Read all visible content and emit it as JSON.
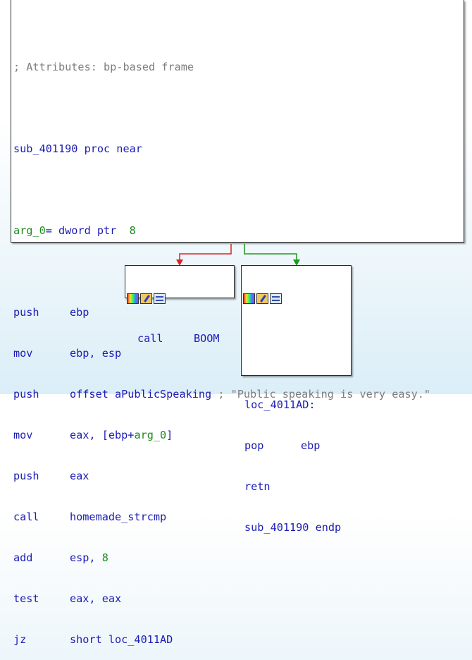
{
  "main_block": {
    "comment": "; Attributes: bp-based frame",
    "proc_name": "sub_401190",
    "proc_keyword": "proc near",
    "arg_name": "arg_0",
    "arg_def": "= dword ptr  ",
    "arg_offset": "8",
    "instructions": [
      {
        "mnemonic": "push",
        "operand": "ebp"
      },
      {
        "mnemonic": "mov",
        "operand": "ebp, esp"
      },
      {
        "mnemonic": "push",
        "operand": "offset aPublicSpeaking",
        "comment": " ; \"Public speaking is very easy.\""
      },
      {
        "mnemonic": "mov",
        "operand_pre": "eax, [ebp+",
        "operand_arg": "arg_0",
        "operand_post": "]"
      },
      {
        "mnemonic": "push",
        "operand": "eax"
      },
      {
        "mnemonic": "call",
        "operand": "homemade_strcmp"
      },
      {
        "mnemonic": "add",
        "operand_pre": "esp, ",
        "operand_num": "8"
      },
      {
        "mnemonic": "test",
        "operand": "eax, eax"
      },
      {
        "mnemonic": "jz",
        "operand": "short loc_4011AD"
      }
    ]
  },
  "left_block": {
    "mnemonic": "call",
    "operand": "BOOM"
  },
  "right_block": {
    "label": "loc_4011AD:",
    "instructions": [
      {
        "mnemonic": "pop",
        "operand": "ebp"
      },
      {
        "mnemonic": "retn",
        "operand": ""
      }
    ],
    "endp": "sub_401190 endp"
  },
  "edge_colors": {
    "false_branch": "#e02020",
    "true_branch": "#1c9a1c"
  },
  "icons": [
    "color-palette-icon",
    "edit-text-icon",
    "graph-view-icon"
  ]
}
